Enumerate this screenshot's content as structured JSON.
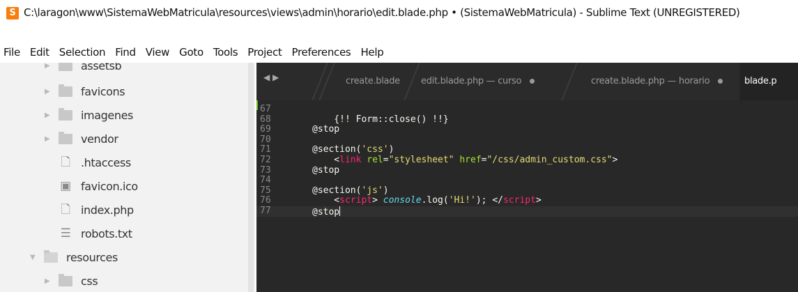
{
  "window": {
    "title": "C:\\laragon\\www\\SistemaWebMatricula\\resources\\views\\admin\\horario\\edit.blade.php • (SistemaWebMatricula) - Sublime Text (UNREGISTERED)",
    "app_icon_letter": "S",
    "app_icon_color": "#f97d0b"
  },
  "menu": [
    "File",
    "Edit",
    "Selection",
    "Find",
    "View",
    "Goto",
    "Tools",
    "Project",
    "Preferences",
    "Help"
  ],
  "sidebar": {
    "items": [
      {
        "label": "assetsb",
        "icon": "folder-icon",
        "expanded": false
      },
      {
        "label": "favicons",
        "icon": "folder-icon",
        "expanded": false
      },
      {
        "label": "imagenes",
        "icon": "folder-icon",
        "expanded": false
      },
      {
        "label": "vendor",
        "icon": "folder-icon",
        "expanded": false
      },
      {
        "label": ".htaccess",
        "icon": "file-icon"
      },
      {
        "label": "favicon.ico",
        "icon": "image-file-icon"
      },
      {
        "label": "index.php",
        "icon": "file-icon"
      },
      {
        "label": "robots.txt",
        "icon": "text-file-icon"
      },
      {
        "label": "resources",
        "icon": "folder-open-icon",
        "expanded": true
      },
      {
        "label": "css",
        "icon": "folder-icon",
        "expanded": false
      }
    ]
  },
  "tabs": [
    {
      "label": "create.blade",
      "modified": false
    },
    {
      "label": "edit.blade.php — curso",
      "modified": true
    },
    {
      "label": "create.blade.php — horario",
      "modified": true
    },
    {
      "label": "blade.p",
      "active": true
    }
  ],
  "tab_nav_glyph": "◀ ▶",
  "editor": {
    "lines": [
      {
        "num": "67",
        "parts": []
      },
      {
        "num": "68",
        "parts": [
          {
            "t": "    {!! Form::close() !!}",
            "c": "kw"
          }
        ]
      },
      {
        "num": "69",
        "parts": [
          {
            "t": "@stop",
            "c": "kw"
          }
        ]
      },
      {
        "num": "70",
        "parts": []
      },
      {
        "num": "71",
        "parts": [
          {
            "t": "@section(",
            "c": "kw"
          },
          {
            "t": "'css'",
            "c": "str"
          },
          {
            "t": ")",
            "c": "kw"
          }
        ]
      },
      {
        "num": "72",
        "parts": [
          {
            "t": "    <",
            "c": "kw"
          },
          {
            "t": "link",
            "c": "tag"
          },
          {
            "t": " ",
            "c": "kw"
          },
          {
            "t": "rel",
            "c": "attr"
          },
          {
            "t": "=",
            "c": "kw"
          },
          {
            "t": "\"stylesheet\"",
            "c": "str"
          },
          {
            "t": " ",
            "c": "kw"
          },
          {
            "t": "href",
            "c": "attr"
          },
          {
            "t": "=",
            "c": "kw"
          },
          {
            "t": "\"/css/admin_custom.css\"",
            "c": "str"
          },
          {
            "t": ">",
            "c": "kw"
          }
        ]
      },
      {
        "num": "73",
        "parts": [
          {
            "t": "@stop",
            "c": "kw"
          }
        ]
      },
      {
        "num": "74",
        "parts": []
      },
      {
        "num": "75",
        "parts": [
          {
            "t": "@section(",
            "c": "kw"
          },
          {
            "t": "'js'",
            "c": "str"
          },
          {
            "t": ")",
            "c": "kw"
          }
        ]
      },
      {
        "num": "76",
        "parts": [
          {
            "t": "    <",
            "c": "kw"
          },
          {
            "t": "script",
            "c": "tag"
          },
          {
            "t": "> ",
            "c": "kw"
          },
          {
            "t": "console",
            "c": "fn"
          },
          {
            "t": ".log(",
            "c": "kw"
          },
          {
            "t": "'Hi!'",
            "c": "str"
          },
          {
            "t": "); </",
            "c": "kw"
          },
          {
            "t": "script",
            "c": "tag"
          },
          {
            "t": ">",
            "c": "kw"
          }
        ]
      },
      {
        "num": "77",
        "parts": [
          {
            "t": "@stop",
            "c": "kw"
          }
        ],
        "current": true
      }
    ]
  }
}
